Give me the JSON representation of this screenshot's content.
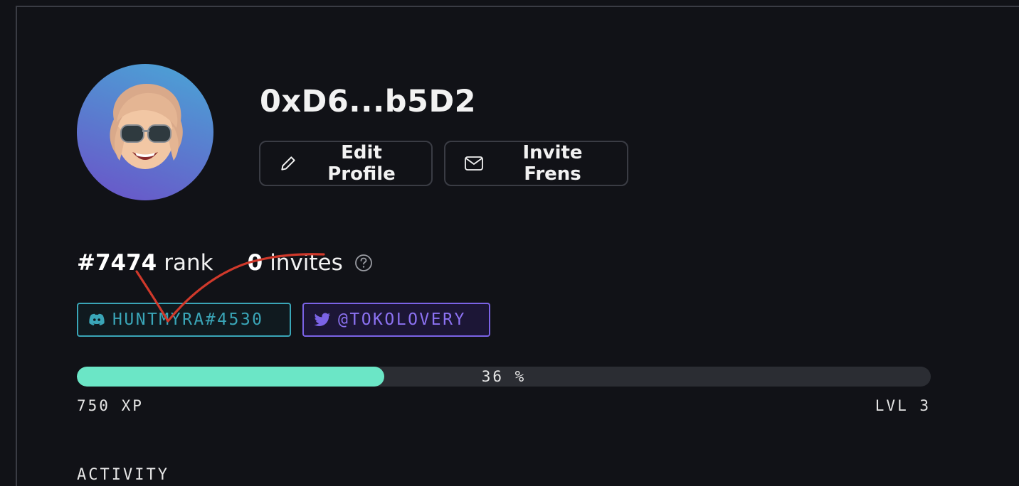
{
  "profile": {
    "username": "0xD6...b5D2",
    "avatar_icon": "memoji-avatar",
    "edit_label": "Edit Profile",
    "invite_label": "Invite Frens"
  },
  "stats": {
    "rank_value": "#7474",
    "rank_label": "rank",
    "invites_value": "0",
    "invites_label": "invites"
  },
  "socials": {
    "discord": "HUNTMYRA#4530",
    "twitter": "@TOKOLOVERY"
  },
  "progress": {
    "percent": 36,
    "percent_label": "36 %",
    "xp": "750 XP",
    "level": "LVL 3"
  },
  "sections": {
    "activity": "ACTIVITY"
  },
  "colors": {
    "accent_green": "#6be6c6",
    "discord": "#3aa6b8",
    "twitter": "#7b63e6",
    "annotation": "#d0392b"
  }
}
